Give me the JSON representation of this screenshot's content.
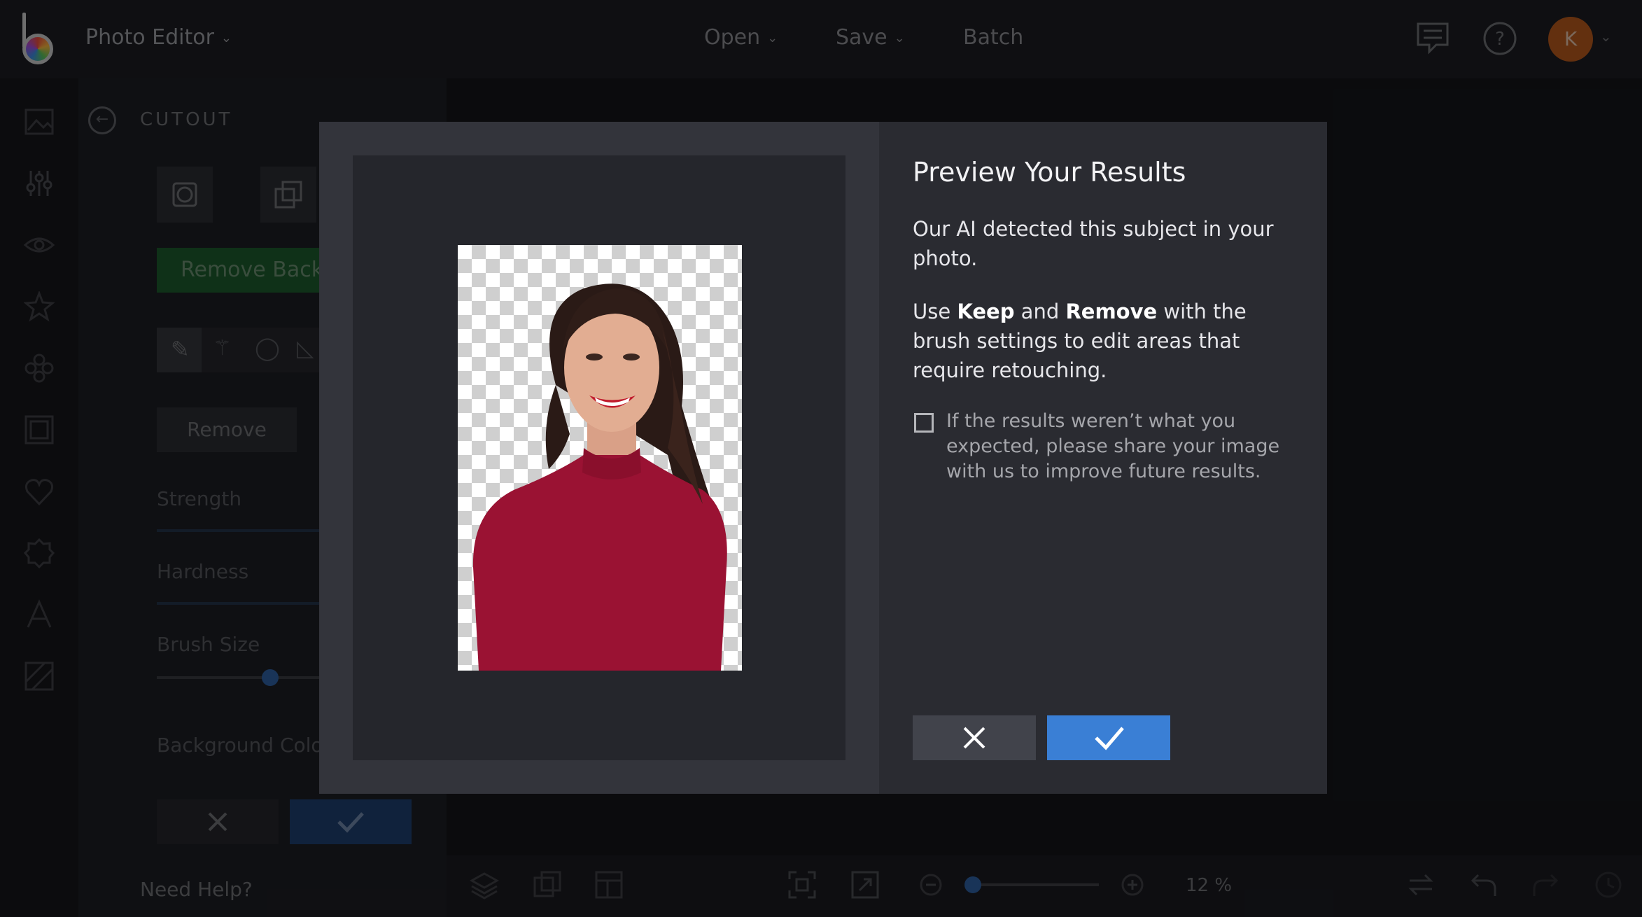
{
  "header": {
    "app_title": "Photo Editor",
    "menu": [
      {
        "label": "Open"
      },
      {
        "label": "Save"
      },
      {
        "label": "Batch"
      }
    ],
    "avatar_initial": "K",
    "icons": [
      "chat-icon",
      "help-icon",
      "chevron-down-icon"
    ]
  },
  "rail": {
    "icons": [
      "image-icon",
      "adjust-sliders-icon",
      "eye-icon",
      "star-icon",
      "flower-icon",
      "frame-icon",
      "heart-icon",
      "badge-icon",
      "text-icon",
      "texture-icon"
    ]
  },
  "panel": {
    "title": "CUTOUT",
    "remove_background_label": "Remove Back",
    "remove_label": "Remove",
    "strength_label": "Strength",
    "hardness_label": "Hardness",
    "brush_size_label": "Brush Size",
    "background_color_label": "Background Colo",
    "need_help": "Need Help?"
  },
  "bottombar": {
    "zoom": "12 %",
    "icons": [
      "layers-icon",
      "compare-icon",
      "layout-icon",
      "fit-screen-icon",
      "expand-icon",
      "zoom-out-icon",
      "zoom-in-icon",
      "swap-icon",
      "undo-icon",
      "redo-icon",
      "history-icon"
    ]
  },
  "modal": {
    "title": "Preview Your Results",
    "paragraph1": "Our AI detected this subject in your photo.",
    "paragraph2": {
      "prefix": "Use ",
      "keep": "Keep",
      "and": " and ",
      "remove": "Remove",
      "suffix": " with the brush settings to edit areas that require retouching."
    },
    "checkbox_label": "If the results weren’t what you expected, please share your image with us to improve future results.",
    "checkbox_checked": false,
    "cancel_icon": "close-icon",
    "confirm_icon": "checkmark-icon",
    "confirm_color": "#3a7fd5"
  }
}
